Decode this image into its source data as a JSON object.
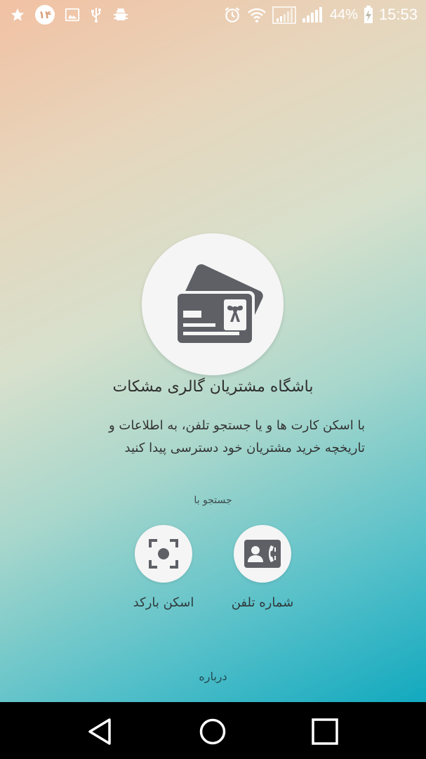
{
  "status_bar": {
    "notification_count": "۱۴",
    "battery_percent": "44%",
    "time": "15:53",
    "icons": [
      "star-icon",
      "notification-badge",
      "image-icon",
      "usb-icon",
      "android-debug-icon",
      "alarm-icon",
      "wifi-icon",
      "signal-icon",
      "signal-icon",
      "battery-charging-icon"
    ]
  },
  "hero": {
    "icon": "membership-cards-icon",
    "title": "باشگاه مشتریان گالری مشکات",
    "description_line1": "با اسکن کارت ها و یا جستجو تلفن، به اطلاعات و",
    "description_line2": "تاریخچه خرید مشتریان خود دسترسی پیدا کنید"
  },
  "search": {
    "heading": "جستجو با",
    "phone": {
      "label": "شماره تلفن",
      "icon": "contact-phone-icon"
    },
    "barcode": {
      "label": "اسکن بارکد",
      "icon": "scan-icon"
    }
  },
  "footer": {
    "about_label": "درباره"
  },
  "nav": {
    "icons": [
      "back-icon",
      "home-icon",
      "recents-icon"
    ]
  },
  "colors": {
    "gradient_top": "#f2c1a3",
    "gradient_bottom": "#12a9bf",
    "icon_gray": "#5e6066",
    "circle_bg": "#f5f5f5"
  }
}
